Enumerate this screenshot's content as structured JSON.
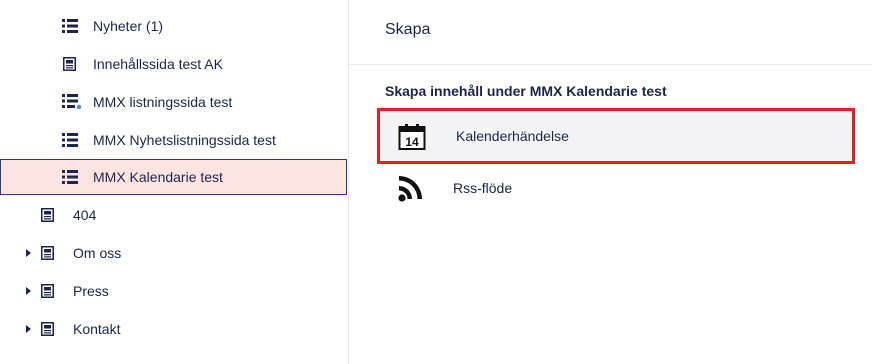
{
  "tree": {
    "items": [
      {
        "label": "Nyheter (1)",
        "icon": "list-icon"
      },
      {
        "label": "Innehållssida test AK",
        "icon": "document-icon"
      },
      {
        "label": "MMX listningssida test",
        "icon": "list-settings-icon"
      },
      {
        "label": "MMX Nyhetslistningssida test",
        "icon": "list-icon"
      },
      {
        "label": "MMX Kalendarie test",
        "icon": "list-icon",
        "selected": true
      },
      {
        "label": "404",
        "icon": "document-icon"
      },
      {
        "label": "Om oss",
        "icon": "document-icon",
        "expandable": true
      },
      {
        "label": "Press",
        "icon": "document-icon",
        "expandable": true
      },
      {
        "label": "Kontakt",
        "icon": "document-icon",
        "expandable": true
      }
    ]
  },
  "panel": {
    "title": "Skapa",
    "subtitle": "Skapa innehåll under MMX Kalendarie test",
    "options": [
      {
        "label": "Kalenderhändelse",
        "icon": "calendar-icon",
        "icon_text": "14",
        "highlighted": true
      },
      {
        "label": "Rss-flöde",
        "icon": "rss-icon"
      }
    ]
  },
  "colors": {
    "text": "#1b264f",
    "selected_bg": "#fde4e1",
    "selected_border": "#2b3a8c",
    "highlight_border": "#e3211c",
    "highlight_bg": "#f3f3f5"
  }
}
